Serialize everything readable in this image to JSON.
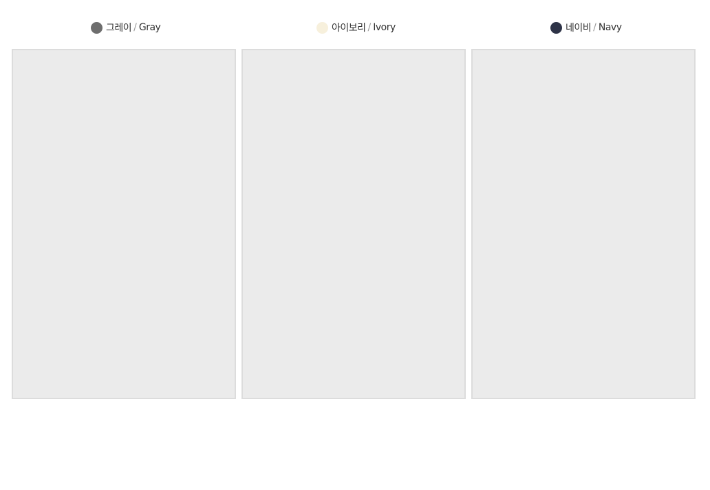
{
  "variants": [
    {
      "name_ko": "그레이",
      "separator": "/",
      "name_en": "Gray",
      "swatch_color": "#6e6e6e",
      "knit_color": "#757575",
      "knit_shade": "#5e5e5e",
      "icon": "gray-cardigan-on-mannequin"
    },
    {
      "name_ko": "아이보리",
      "separator": "/",
      "name_en": "Ivory",
      "swatch_color": "#f7f0dc",
      "knit_color": "#f6f2e0",
      "knit_shade": "#e6e0c9",
      "icon": "ivory-cardigan-on-mannequin"
    },
    {
      "name_ko": "네이비",
      "separator": "/",
      "name_en": "Navy",
      "swatch_color": "#2e3347",
      "knit_color": "#262a3b",
      "knit_shade": "#1a1d2a",
      "icon": "navy-cardigan-on-mannequin"
    }
  ],
  "colors": {
    "photo_background": "#ebebeb",
    "frame_border": "#dcdcdc",
    "shirt_stripe": "#9fb3d6",
    "heart_embroidery": "#b0243a"
  }
}
